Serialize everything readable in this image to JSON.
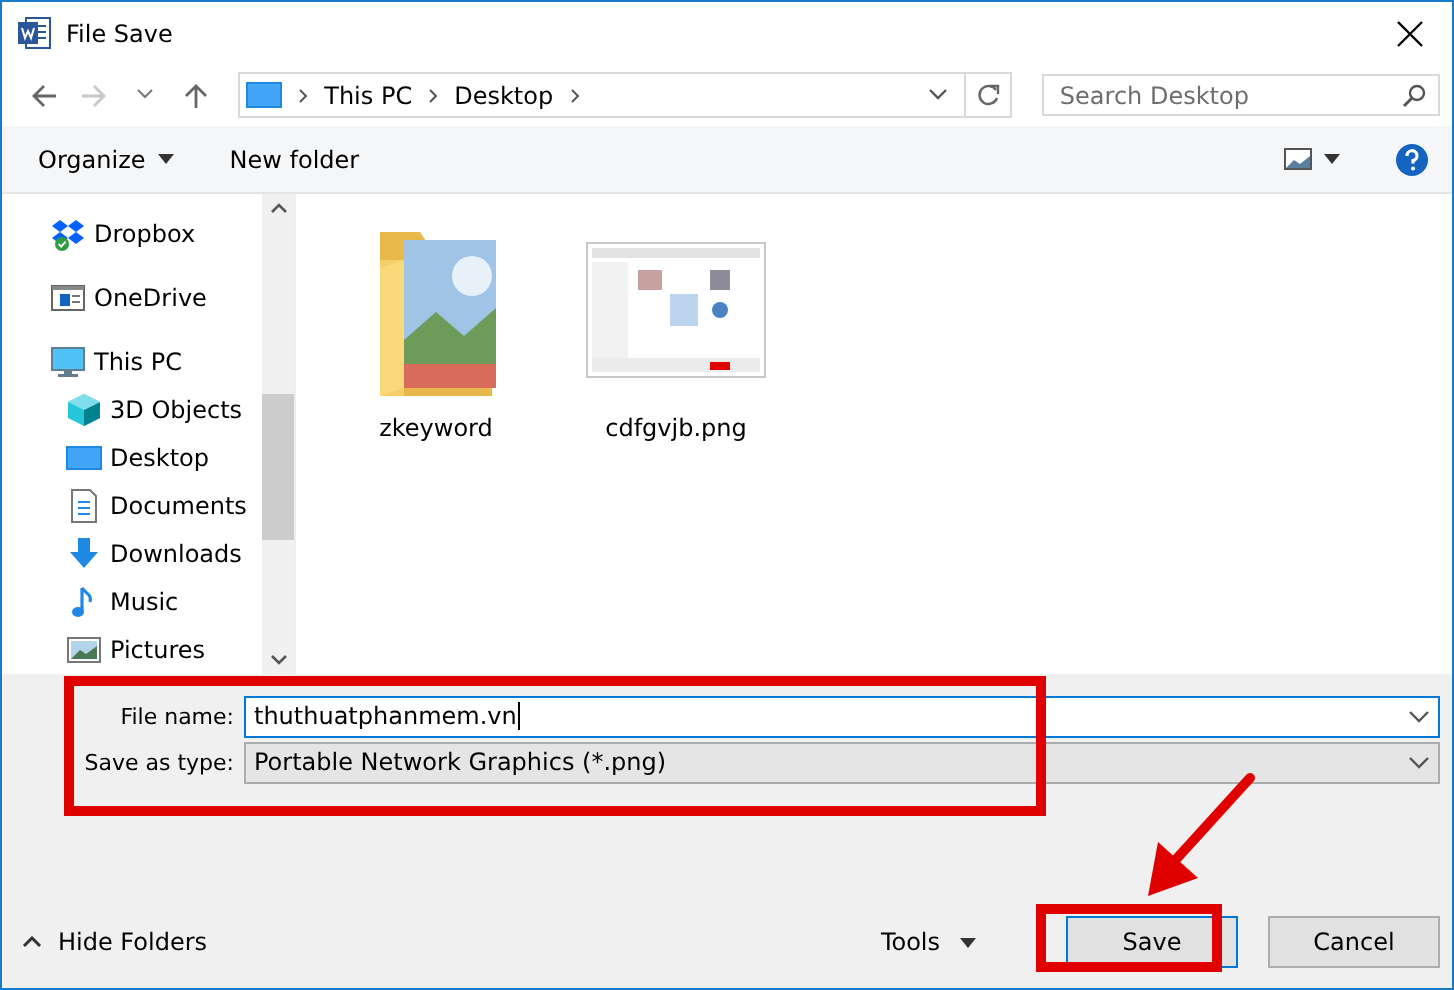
{
  "window": {
    "title": "File Save"
  },
  "nav": {
    "path": [
      {
        "label": "This PC"
      },
      {
        "label": "Desktop"
      }
    ],
    "search": {
      "placeholder": "Search Desktop"
    }
  },
  "toolbar": {
    "organize": "Organize",
    "new_folder": "New folder"
  },
  "sidebar": {
    "items": [
      {
        "label": "Dropbox",
        "kind": "dropbox"
      },
      {
        "label": "OneDrive",
        "kind": "onedrive"
      },
      {
        "label": "This PC",
        "kind": "pc",
        "children": [
          {
            "label": "3D Objects",
            "kind": "cube"
          },
          {
            "label": "Desktop",
            "kind": "desktop"
          },
          {
            "label": "Documents",
            "kind": "document"
          },
          {
            "label": "Downloads",
            "kind": "download"
          },
          {
            "label": "Music",
            "kind": "music"
          },
          {
            "label": "Pictures",
            "kind": "pictures"
          }
        ]
      }
    ]
  },
  "files": [
    {
      "name": "zkeyword",
      "kind": "folder"
    },
    {
      "name": "cdfgvjb.png"
    }
  ],
  "form": {
    "file_name": {
      "label": "File name:",
      "value": "thuthuatphanmem.vn"
    },
    "save_as_type": {
      "label": "Save as type:",
      "value": "Portable Network Graphics (*.png)"
    }
  },
  "footer": {
    "hide_folders": "Hide Folders",
    "tools": "Tools",
    "buttons": [
      {
        "label": "Save",
        "kind": "primary"
      },
      {
        "label": "Cancel",
        "kind": "secondary"
      }
    ]
  },
  "annotations": [
    {
      "kind": "form-box"
    },
    {
      "kind": "save-box"
    },
    {
      "kind": "arrow"
    }
  ]
}
